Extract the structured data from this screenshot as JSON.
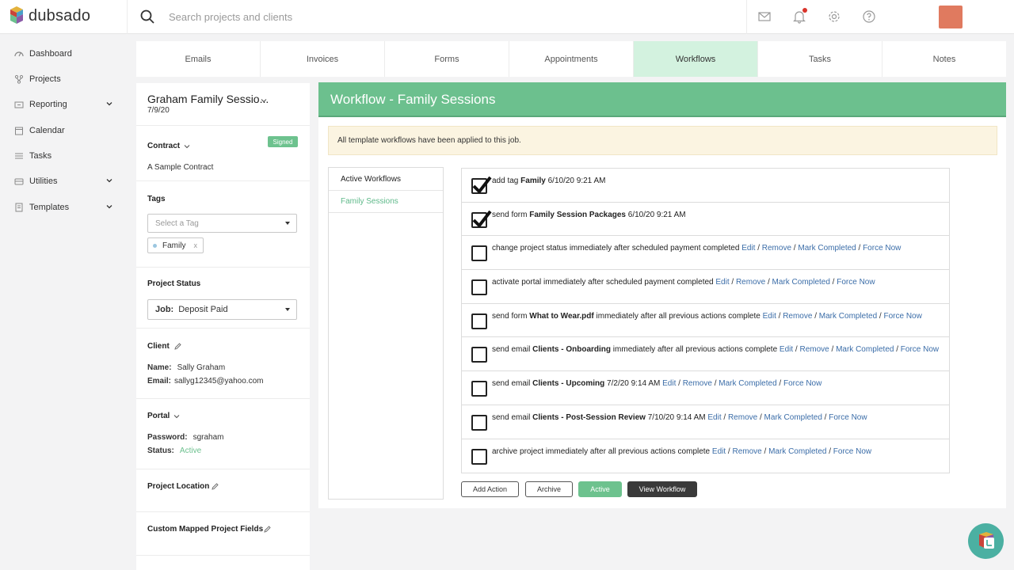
{
  "app": {
    "name": "dubsado"
  },
  "search": {
    "placeholder": "Search projects and clients"
  },
  "sidebar": {
    "items": [
      {
        "label": "Dashboard",
        "icon": "dashboard-icon"
      },
      {
        "label": "Projects",
        "icon": "projects-icon"
      },
      {
        "label": "Reporting",
        "icon": "reporting-icon",
        "expandable": true
      },
      {
        "label": "Calendar",
        "icon": "calendar-icon"
      },
      {
        "label": "Tasks",
        "icon": "tasks-icon"
      },
      {
        "label": "Utilities",
        "icon": "utilities-icon",
        "expandable": true
      },
      {
        "label": "Templates",
        "icon": "templates-icon",
        "expandable": true
      }
    ]
  },
  "tabs": [
    {
      "label": "Emails"
    },
    {
      "label": "Invoices"
    },
    {
      "label": "Forms"
    },
    {
      "label": "Appointments"
    },
    {
      "label": "Workflows",
      "active": true
    },
    {
      "label": "Tasks"
    },
    {
      "label": "Notes"
    }
  ],
  "project": {
    "title": "Graham Family Sessio...",
    "date": "7/9/20",
    "contract_label": "Contract",
    "contract_badge": "Signed",
    "contract_name": "A Sample Contract",
    "tags_label": "Tags",
    "tags_placeholder": "Select a Tag",
    "tag": "Family",
    "tag_remove": "x",
    "status_label": "Project Status",
    "status_prefix": "Job:",
    "status_value": "Deposit Paid",
    "client_label": "Client",
    "client_name_label": "Name:",
    "client_name": "Sally Graham",
    "client_email_label": "Email:",
    "client_email": "sallyg12345@yahoo.com",
    "portal_label": "Portal",
    "password_label": "Password:",
    "password": "sgraham",
    "portal_status_label": "Status:",
    "portal_status": "Active",
    "location_label": "Project Location",
    "custom_fields_label": "Custom Mapped Project Fields"
  },
  "workflow": {
    "title": "Workflow - Family Sessions",
    "notice": "All template workflows have been applied to this job.",
    "list_header": "Active Workflows",
    "list_items": [
      "Family Sessions"
    ],
    "link_labels": {
      "edit": "Edit",
      "remove": "Remove",
      "mark": "Mark Completed",
      "force": "Force Now"
    },
    "actions": [
      {
        "completed": true,
        "pre": "add tag ",
        "bold": "Family",
        "post": " 6/10/20 9:21 AM"
      },
      {
        "completed": true,
        "pre": "send form ",
        "bold": "Family Session Packages",
        "post": " 6/10/20 9:21 AM"
      },
      {
        "completed": false,
        "pre": "change project status immediately after scheduled payment completed",
        "bold": "",
        "post": ""
      },
      {
        "completed": false,
        "pre": "activate portal immediately after scheduled payment completed",
        "bold": "",
        "post": ""
      },
      {
        "completed": false,
        "pre": "send form ",
        "bold": "What to Wear.pdf",
        "post": " immediately after all previous actions complete"
      },
      {
        "completed": false,
        "pre": "send email ",
        "bold": "Clients - Onboarding",
        "post": " immediately after all previous actions complete"
      },
      {
        "completed": false,
        "pre": "send email ",
        "bold": "Clients - Upcoming",
        "post": " 7/2/20 9:14 AM"
      },
      {
        "completed": false,
        "pre": "send email ",
        "bold": "Clients - Post-Session Review",
        "post": " 7/10/20 9:14 AM"
      },
      {
        "completed": false,
        "pre": "archive project immediately after all previous actions complete",
        "bold": "",
        "post": ""
      }
    ],
    "buttons": {
      "add_action": "Add Action",
      "archive": "Archive",
      "active": "Active",
      "view_workflow": "View Workflow"
    }
  },
  "colors": {
    "accent_green": "#6cc08e",
    "active_tab": "#d3f2df",
    "link_blue": "#3b6da8"
  }
}
